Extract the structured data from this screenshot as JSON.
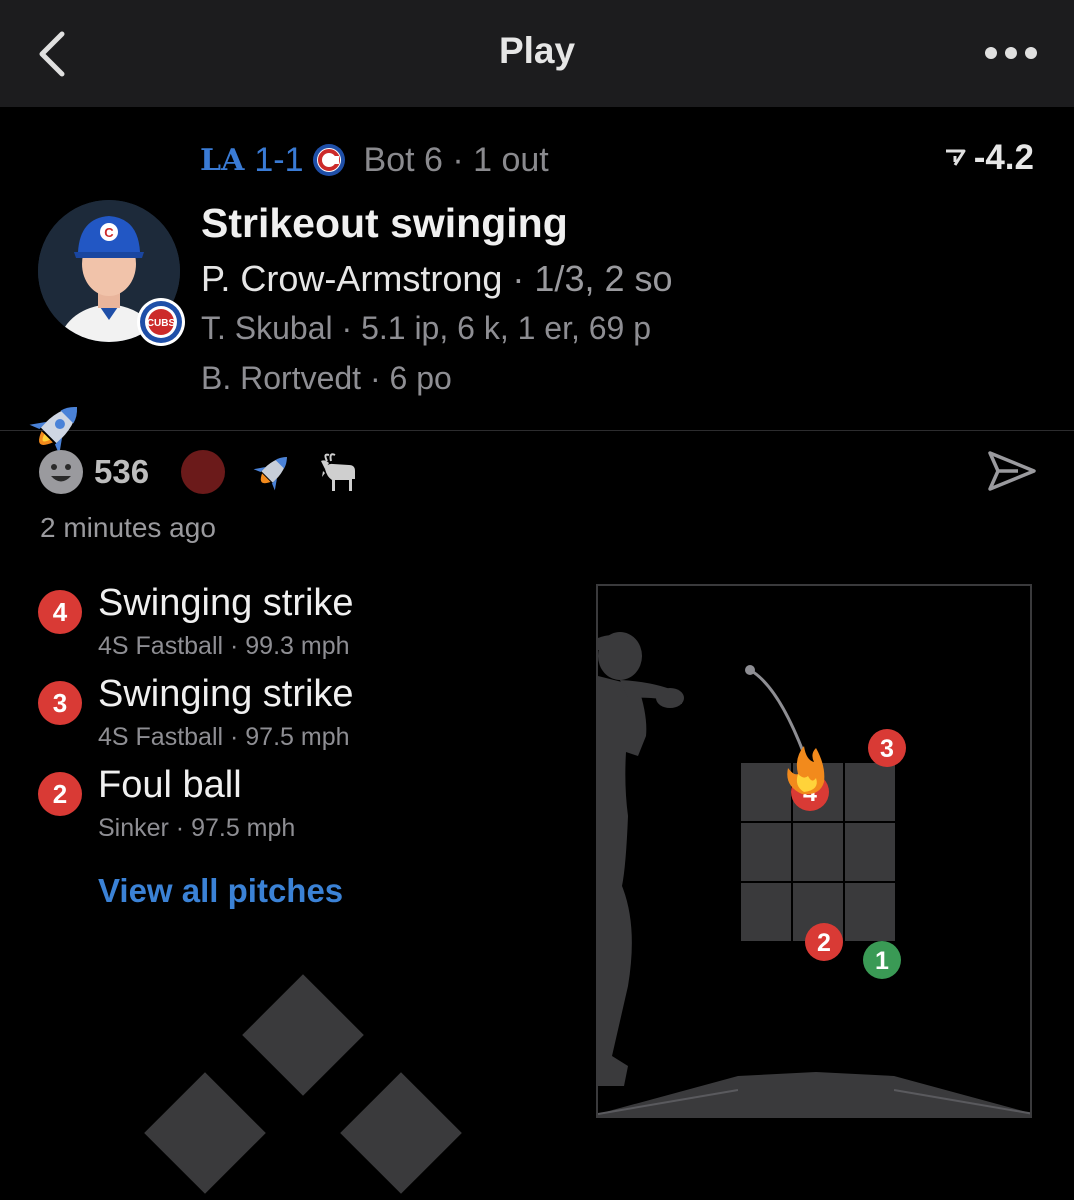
{
  "nav": {
    "title": "Play"
  },
  "header": {
    "away_team": "LA",
    "score": "1-1",
    "inning": "Bot 6 · 1 out",
    "wpa": "-4.2"
  },
  "play": {
    "title": "Strikeout swinging",
    "batter_name": "P. Crow-Armstrong",
    "batter_stat": " · 1/3, 2 so",
    "pitcher_line": "T. Skubal · 5.1 ip, 6 k, 1 er, 69 p",
    "fielder_line": "B. Rortvedt · 6 po",
    "team_badge": "CUBS"
  },
  "reactions": {
    "count": "536",
    "timestamp": "2 minutes ago"
  },
  "pitches": [
    {
      "number": "4",
      "result": "Swinging strike",
      "detail": "4S Fastball ·  99.3 mph",
      "color": "#d93a35"
    },
    {
      "number": "3",
      "result": "Swinging strike",
      "detail": "4S Fastball ·  97.5 mph",
      "color": "#d93a35"
    },
    {
      "number": "2",
      "result": "Foul ball",
      "detail": "Sinker ·  97.5 mph",
      "color": "#d93a35"
    }
  ],
  "zone_markers": [
    {
      "number": "3",
      "color": "#d93a35"
    },
    {
      "number": "4",
      "color": "#d93a35"
    },
    {
      "number": "2",
      "color": "#d93a35"
    },
    {
      "number": "1",
      "color": "#3a9a55"
    }
  ],
  "view_all_label": "View all pitches",
  "colors": {
    "accent_blue": "#3b82d6",
    "strike_red": "#d93a35",
    "ball_green": "#3a9a55",
    "background": "#000000",
    "navbar": "#1c1c1e"
  },
  "icons": [
    "back-chevron-icon",
    "more-dots-icon",
    "dodgers-logo-icon",
    "cubs-logo-icon",
    "wpa-arrow-icon",
    "smile-icon",
    "rocket-icon",
    "goat-icon",
    "share-icon"
  ]
}
